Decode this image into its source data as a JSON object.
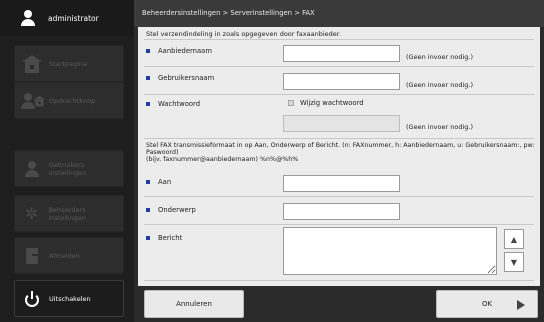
{
  "user": {
    "name": "administrator"
  },
  "nav": {
    "home": "Startpagina",
    "jobs": "Opdrachtknop",
    "user_settings": "Gebruikers instellingen",
    "admin_settings": "Beheerders instellingen",
    "logout": "Afmelden",
    "shutdown": "Uitschakelen"
  },
  "breadcrumb": "Beheerdersinstellingen > Serverinstellingen > FAX",
  "intro": "Stel verzendindeling in zoals opgegeven door faxaanbieder.",
  "fields": {
    "provider_name": {
      "label": "Aanbiedernaam",
      "value": "",
      "hint": "(Geen invoer nodig.)"
    },
    "username": {
      "label": "Gebruikersnaam",
      "value": "",
      "hint": "(Geen invoer nodig.)"
    },
    "password": {
      "label": "Wachtwoord",
      "change_label": "Wijzig wachtwoord",
      "value": "",
      "hint": "(Geen invoer nodig.)"
    }
  },
  "format_text": "Stel FAX transmissieformaat in op Aan, Onderwerp of Bericht. (n: FAXnummer, h: Aanbiedernaam, u: Gebruikersnaam:, pw: Paswoord)\n(bijv. faxnummer@aanbiedernaam) %n%@%h%",
  "format_fields": {
    "to": {
      "label": "Aan",
      "value": ""
    },
    "subject": {
      "label": "Onderwerp",
      "value": ""
    },
    "message": {
      "label": "Bericht",
      "value": ""
    }
  },
  "buttons": {
    "cancel": "Annuleren",
    "ok": "OK"
  },
  "icons": {
    "scroll_up": "▲",
    "scroll_down": "▼",
    "gear": "✲"
  },
  "colors": {
    "bullet": "#1f3ea6",
    "sidebar": "#1e1e1e",
    "content": "#ececec"
  }
}
